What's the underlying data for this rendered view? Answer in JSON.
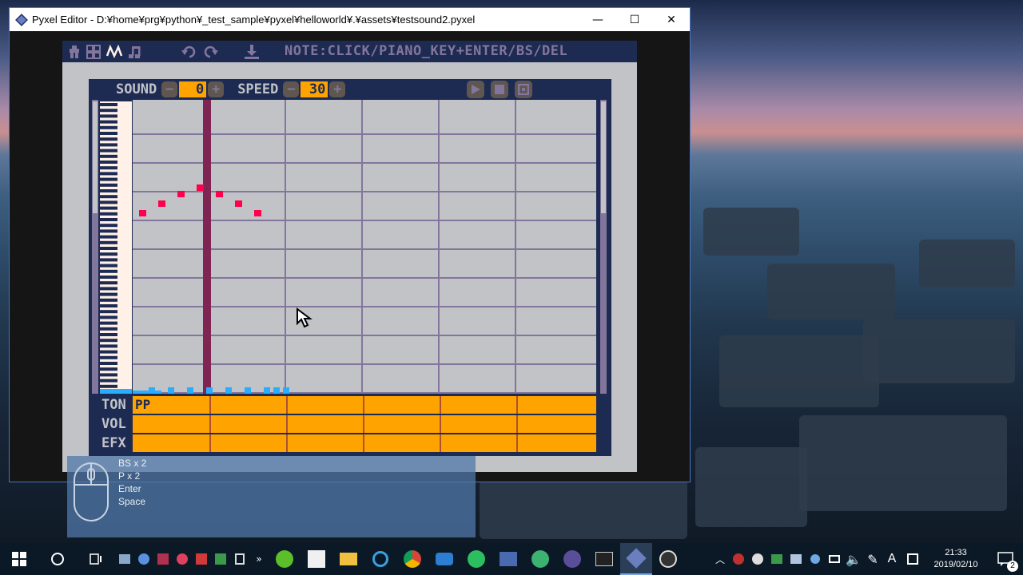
{
  "window": {
    "title": "Pyxel Editor - D:¥home¥prg¥python¥_test_sample¥pyxel¥helloworld¥.¥assets¥testsound2.pyxel",
    "minimize_glyph": "—",
    "maximize_glyph": "☐",
    "close_glyph": "✕"
  },
  "toolbar": {
    "note_text": "NOTE:CLICK/PIANO_KEY+ENTER/BS/DEL",
    "icons": [
      "image-editor-icon",
      "tilemap-editor-icon",
      "sound-editor-icon",
      "music-editor-icon",
      "undo-icon",
      "redo-icon",
      "save-icon"
    ]
  },
  "editor": {
    "sound_label": "SOUND",
    "sound_value": "0",
    "speed_label": "SPEED",
    "speed_value": "30",
    "minus_glyph": "−",
    "plus_glyph": "+"
  },
  "rows": {
    "ton_label": "TON",
    "ton_value": "PP",
    "vol_label": "VOL",
    "efx_label": "EFX"
  },
  "key_overlay": {
    "lines": [
      "BS x 2",
      "P x 2",
      "Enter",
      "Space"
    ]
  },
  "taskbar": {
    "time": "21:33",
    "date": "2019/02/10",
    "notification_count": "2",
    "ime_indicator": "A"
  },
  "colors": {
    "pyxel_navy": "#1d2b53",
    "pyxel_orange": "#ffa300",
    "pyxel_red": "#ff004d",
    "pyxel_blue": "#29adff",
    "pyxel_gray": "#c2c3c7",
    "pyxel_lavender": "#83769c",
    "playhead": "#7e2553"
  }
}
